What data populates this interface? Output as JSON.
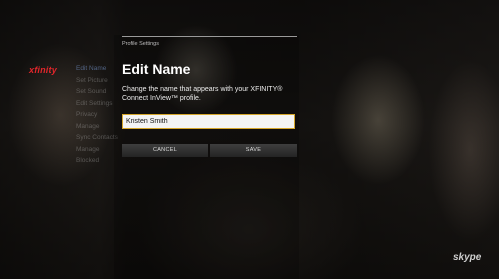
{
  "brand": {
    "logo_text": "xfinity",
    "accent_color": "#e3262b"
  },
  "sidebar": {
    "items": [
      {
        "label": "Edit Name",
        "active": true
      },
      {
        "label": "Set Picture",
        "active": false
      },
      {
        "label": "Set Sound",
        "active": false
      },
      {
        "label": "Edit Settings",
        "active": false
      },
      {
        "label": "Privacy",
        "active": false
      },
      {
        "label": "Manage",
        "active": false
      },
      {
        "label": "Sync Contacts",
        "active": false
      },
      {
        "label": "Manage",
        "active": false
      },
      {
        "label": "Blocked",
        "active": false
      }
    ]
  },
  "dialog": {
    "breadcrumb": "Profile Settings",
    "title": "Edit Name",
    "description": "Change the name that appears with your XFINITY® Connect InView™ profile.",
    "name_value": "Kristen Smith",
    "cancel_label": "CANCEL",
    "save_label": "SAVE",
    "focus_color": "#d4a52a"
  },
  "footer": {
    "skype_logo": "skype"
  }
}
